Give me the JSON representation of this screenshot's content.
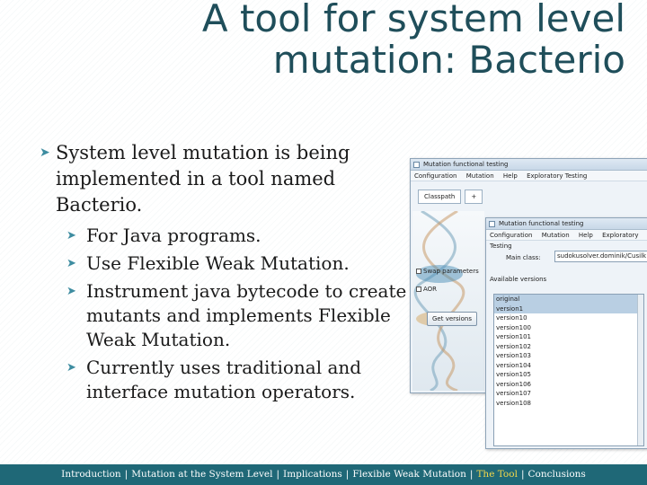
{
  "title": "A tool for system level mutation: Bacterio",
  "main_bullet": "System level mutation is being implemented in a tool named Bacterio.",
  "sub_bullets": [
    "For Java programs.",
    "Use Flexible Weak Mutation.",
    "Instrument java bytecode to create mutants and implements Flexible Weak Mutation.",
    " Currently uses traditional and interface mutation operators."
  ],
  "screenshot_back": {
    "window_title": "Mutation functional testing",
    "menus": [
      "Configuration",
      "Mutation",
      "Help",
      "Exploratory Testing"
    ],
    "tabs": [
      "Classpath",
      "+"
    ],
    "options": [
      "Swap parameters",
      "AOR"
    ],
    "button": "Get versions"
  },
  "screenshot_front": {
    "window_title": "Mutation functional testing",
    "menus": [
      "Configuration",
      "Mutation",
      "Help",
      "Exploratory Testing"
    ],
    "main_class_label": "Main class:",
    "main_class_value": "sudokusolver.dominik/Cusilk",
    "versions_header": "Available versions",
    "versions": [
      "original",
      "version1",
      "version10",
      "version100",
      "version101",
      "version102",
      "version103",
      "version104",
      "version105",
      "version106",
      "version107",
      "version108"
    ],
    "selected_count": 2
  },
  "footer": {
    "items": [
      "Introduction",
      "Mutation at the System Level",
      "Implications",
      "Flexible Weak Mutation",
      "The Tool",
      "Conclusions"
    ],
    "active": "The Tool",
    "separator": "|",
    "active_color": "#f2d64b",
    "bar_color": "#1f6877"
  }
}
